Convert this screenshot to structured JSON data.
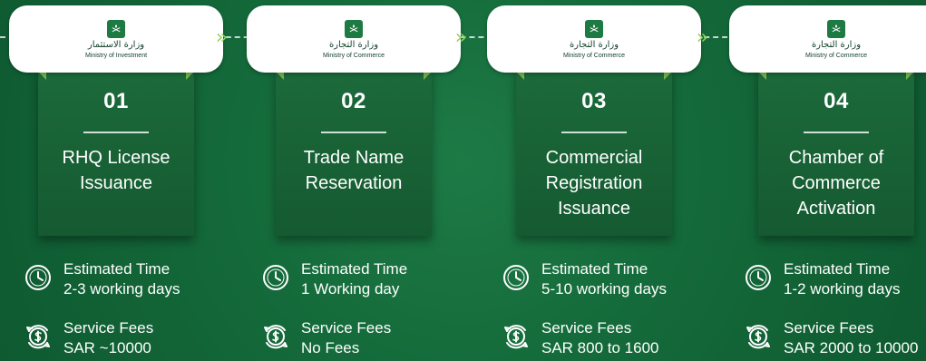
{
  "steps": [
    {
      "number": "01",
      "title_lines": [
        "RHQ License",
        "Issuance"
      ],
      "logo": {
        "ministry_ar": "وزارة الاستثمار",
        "ministry_en": "Ministry of Investment"
      },
      "time_label": "Estimated Time",
      "time_value": "2-3 working days",
      "fees_label": "Service Fees",
      "fees_value": "SAR ~10000"
    },
    {
      "number": "02",
      "title_lines": [
        "Trade Name",
        "Reservation"
      ],
      "logo": {
        "ministry_ar": "وزارة التجارة",
        "ministry_en": "Ministry of Commerce"
      },
      "time_label": "Estimated Time",
      "time_value": "1 Working day",
      "fees_label": "Service Fees",
      "fees_value": "No Fees"
    },
    {
      "number": "03",
      "title_lines": [
        "Commercial",
        "Registration",
        "Issuance"
      ],
      "logo": {
        "ministry_ar": "وزارة التجارة",
        "ministry_en": "Ministry of Commerce"
      },
      "time_label": "Estimated Time",
      "time_value": "5-10 working days",
      "fees_label": "Service Fees",
      "fees_value": "SAR 800 to 1600"
    },
    {
      "number": "04",
      "title_lines": [
        "Chamber of",
        "Commerce",
        "Activation"
      ],
      "logo": {
        "ministry_ar": "وزارة التجارة",
        "ministry_en": "Ministry of Commerce"
      },
      "time_label": "Estimated Time",
      "time_value": "1-2 working days",
      "fees_label": "Service Fees",
      "fees_value": "SAR 2000 to 10000"
    }
  ],
  "ui": {
    "chevron_symbol": "»",
    "colors": {
      "background": "#146a3a",
      "ribbon": "#1c6a3b",
      "accent": "#8fd15b",
      "logo_card": "#ffffff"
    },
    "icons": {
      "time": "clock-icon",
      "fees": "money-fees-icon",
      "emblem": "saudi-emblem-icon"
    }
  }
}
